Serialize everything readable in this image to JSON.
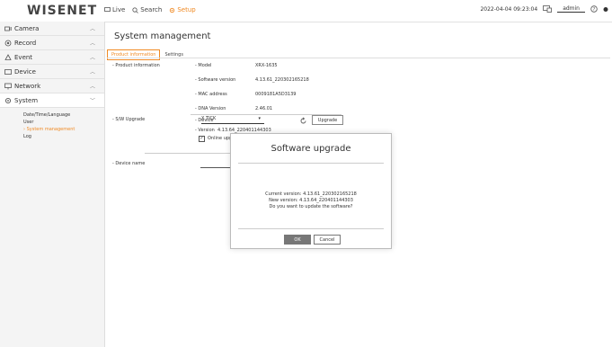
{
  "header": {
    "logo": "WISENET",
    "nav": {
      "live": "Live",
      "search": "Search",
      "setup": "Setup"
    },
    "datetime": "2022-04-04 09:23:04",
    "user": "admin",
    "accent": "#f08a24"
  },
  "sidebar": {
    "items": [
      {
        "label": "Camera"
      },
      {
        "label": "Record"
      },
      {
        "label": "Event"
      },
      {
        "label": "Device"
      },
      {
        "label": "Network"
      },
      {
        "label": "System"
      }
    ],
    "submenu": [
      "Date/Time/Language",
      "User",
      "System management",
      "Log"
    ]
  },
  "main": {
    "title": "System management",
    "tabs": [
      "Product information",
      "Settings"
    ],
    "product_info": {
      "section": "Product information",
      "fields": [
        {
          "label": "Model",
          "value": "XRX-1635"
        },
        {
          "label": "Software version",
          "value": "4.13.61_220302165218"
        },
        {
          "label": "MAC address",
          "value": "0009181A5D3139"
        },
        {
          "label": "DNA Version",
          "value": "2.46.01"
        }
      ]
    },
    "upgrade": {
      "section": "S/W Upgrade",
      "device_label": "Device",
      "device_value": "X TICK",
      "version_label": "Version",
      "version_value": "4.13.64_220401144303",
      "online_label": "Online upgrade",
      "upgrade_button": "Upgrade"
    },
    "device_name": {
      "section": "Device name"
    }
  },
  "dialog": {
    "title": "Software upgrade",
    "line1": "Current version: 4.13.61_220302165218",
    "line2": "New version: 4.13.64_220401144303",
    "line3": "Do you want to update the software?",
    "ok": "OK",
    "cancel": "Cancel"
  }
}
